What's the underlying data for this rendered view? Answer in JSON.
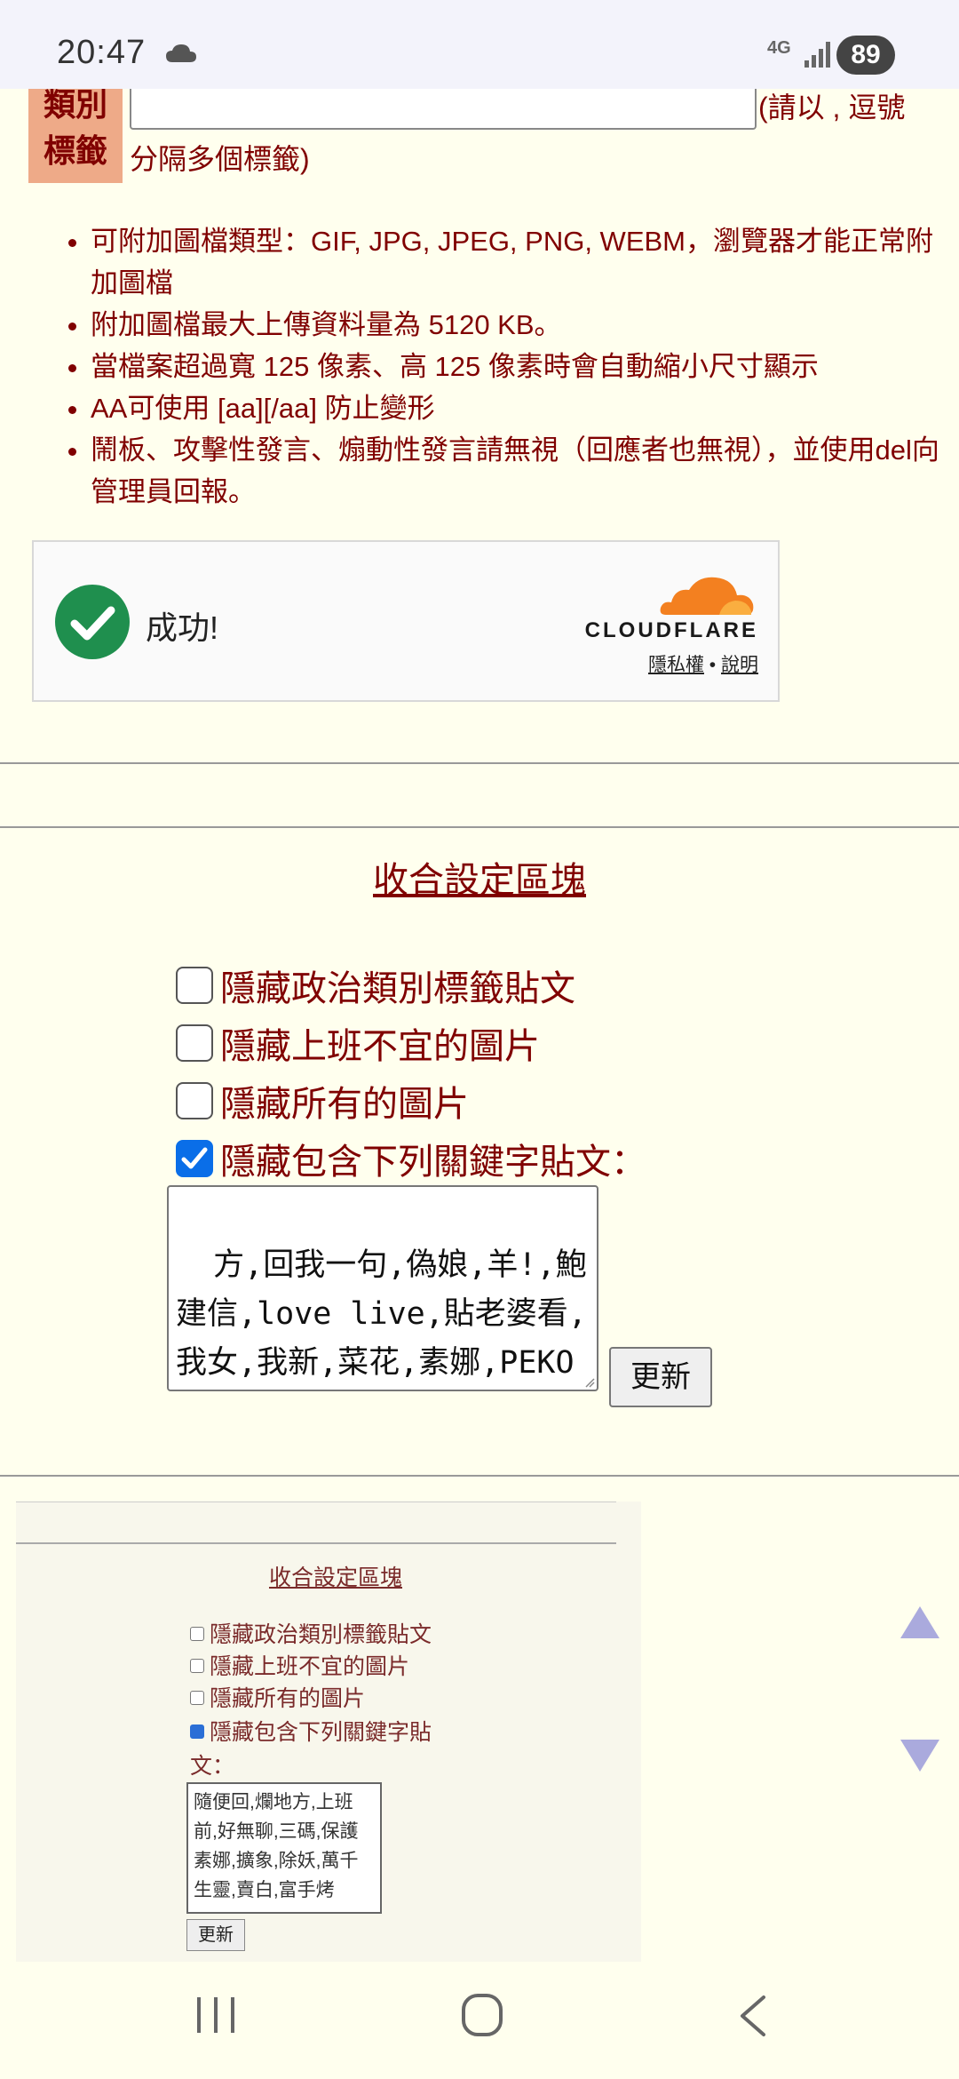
{
  "status_bar": {
    "time": "20:47",
    "network": "4G",
    "battery": "89"
  },
  "category": {
    "label_line1": "類別",
    "label_line2": "標籤",
    "input_value": "",
    "hint": "(請以 , 逗號分隔多個標籤)"
  },
  "rules": [
    "可附加圖檔類型：GIF, JPG, JPEG, PNG, WEBM，瀏覽器才能正常附加圖檔",
    "附加圖檔最大上傳資料量為 5120 KB。",
    "當檔案超過寬 125 像素、高 125 像素時會自動縮小尺寸顯示",
    "AA可使用 [aa][/aa] 防止變形",
    "鬧板、攻擊性發言、煽動性發言請無視（回應者也無視），並使用del向管理員回報。"
  ],
  "cloudflare": {
    "success_text": "成功!",
    "brand": "CLOUDFLARE",
    "privacy_link": "隱私權",
    "separator": "•",
    "help_link": "說明",
    "logo_color": "#f38020",
    "check_color": "#1f8f4e"
  },
  "collapse": {
    "title": "收合設定區塊",
    "options": [
      {
        "label": "隱藏政治類別標籤貼文",
        "checked": false
      },
      {
        "label": "隱藏上班不宜的圖片",
        "checked": false
      },
      {
        "label": "隱藏所有的圖片",
        "checked": false
      },
      {
        "label": "隱藏包含下列關鍵字貼文：",
        "checked": true
      }
    ],
    "keywords": "方,回我一句,偽娘,羊!,鮑建信,love live,貼老婆看,我女,我新,菜花,素娜,PEKO",
    "update_label": "更新"
  },
  "embedded_screenshot": {
    "title": "收合設定區塊",
    "options": [
      {
        "label": "隱藏政治類別標籤貼文",
        "checked": false
      },
      {
        "label": "隱藏上班不宜的圖片",
        "checked": false
      },
      {
        "label": "隱藏所有的圖片",
        "checked": false
      },
      {
        "label": "隱藏包含下列關鍵字貼",
        "checked": true
      }
    ],
    "keyword_label": "文：",
    "keywords": "隨便回,爛地方,上班前,好無聊,三碼,保護素娜,擴象,除妖,萬千生靈,賣白,富手烤",
    "update_label": "更新"
  },
  "scroll": {
    "up": "scroll-up",
    "down": "scroll-down",
    "arrow_color": "#aaaadd"
  },
  "nav": {
    "recent": "recent-apps",
    "home": "home",
    "back": "back"
  }
}
